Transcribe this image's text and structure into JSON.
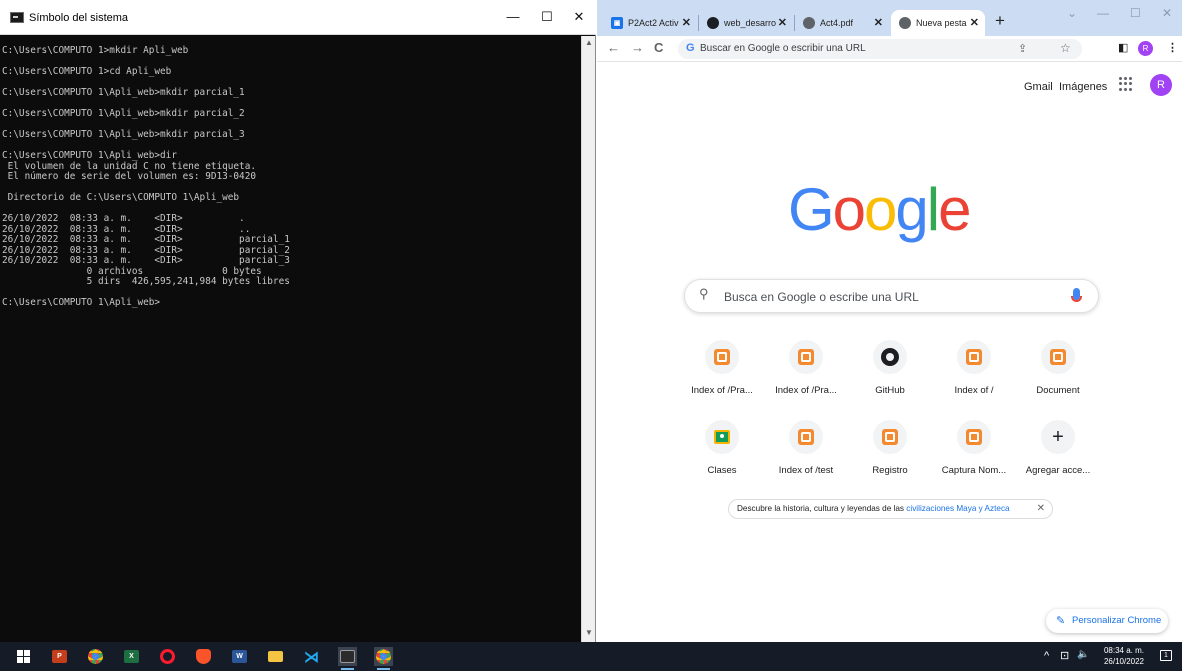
{
  "cmd": {
    "title": "Símbolo del sistema",
    "icon": "cmd-app-icon",
    "controls": {
      "minimize": "—",
      "maximize": "☐",
      "close": "✕"
    },
    "output": "C:\\Users\\COMPUTO 1>mkdir Apli_web\n\nC:\\Users\\COMPUTO 1>cd Apli_web\n\nC:\\Users\\COMPUTO 1\\Apli_web>mkdir parcial_1\n\nC:\\Users\\COMPUTO 1\\Apli_web>mkdir parcial_2\n\nC:\\Users\\COMPUTO 1\\Apli_web>mkdir parcial_3\n\nC:\\Users\\COMPUTO 1\\Apli_web>dir\n El volumen de la unidad C no tiene etiqueta.\n El número de serie del volumen es: 9D13-0420\n\n Directorio de C:\\Users\\COMPUTO 1\\Apli_web\n\n26/10/2022  08:33 a. m.    <DIR>          .\n26/10/2022  08:33 a. m.    <DIR>          ..\n26/10/2022  08:33 a. m.    <DIR>          parcial_1\n26/10/2022  08:33 a. m.    <DIR>          parcial_2\n26/10/2022  08:33 a. m.    <DIR>          parcial_3\n               0 archivos              0 bytes\n               5 dirs  426,595,241,984 bytes libres\n\nC:\\Users\\COMPUTO 1\\Apli_web>"
  },
  "chrome": {
    "tabs": [
      {
        "label": "P2Act2 Activ",
        "favicon": "classroom-icon",
        "color": "#1a73e8"
      },
      {
        "label": "web_desarro",
        "favicon": "github-icon",
        "color": "#1b1f23"
      },
      {
        "label": "Act4.pdf",
        "favicon": "globe-icon",
        "color": "#5f6368"
      },
      {
        "label": "Nueva pesta",
        "favicon": "chrome-icon",
        "color": "#5f6368",
        "active": true
      }
    ],
    "tab_close": "✕",
    "new_tab": "+",
    "window_controls": {
      "chevron": "⌄",
      "minimize": "—",
      "maximize": "☐",
      "close": "✕"
    },
    "toolbar": {
      "back": "←",
      "forward": "→",
      "reload": "C",
      "omnibox_placeholder": "Buscar en Google o escribir una URL",
      "avatar_letter": "R",
      "menu": "⋮"
    },
    "ntp": {
      "links": {
        "gmail": "Gmail",
        "images": "Imágenes"
      },
      "avatar_letter": "R",
      "logo": [
        "G",
        "o",
        "o",
        "g",
        "l",
        "e"
      ],
      "search_placeholder": "Busca en Google o escribe una URL",
      "shortcuts": [
        {
          "label": "Index of /Pra...",
          "icon": "xampp-icon"
        },
        {
          "label": "Index of /Pra...",
          "icon": "xampp-icon"
        },
        {
          "label": "GitHub",
          "icon": "github-icon"
        },
        {
          "label": "Index of /",
          "icon": "xampp-icon"
        },
        {
          "label": "Document",
          "icon": "xampp-icon"
        },
        {
          "label": "Clases",
          "icon": "classroom-icon"
        },
        {
          "label": "Index of /test",
          "icon": "xampp-icon"
        },
        {
          "label": "Registro",
          "icon": "xampp-icon"
        },
        {
          "label": "Captura Nom...",
          "icon": "xampp-icon"
        },
        {
          "label": "Agregar acce...",
          "icon": "plus-icon"
        }
      ],
      "promo": {
        "text": "Descubre la historia, cultura y leyendas de las ",
        "link": "civilizaciones Maya y Azteca",
        "close": "✕"
      },
      "customize_label": "Personalizar Chrome"
    }
  },
  "taskbar": {
    "apps": [
      {
        "name": "start",
        "icon": "windows-icon"
      },
      {
        "name": "powerpoint",
        "icon": "powerpoint-icon",
        "color": "#c43e1c",
        "letter": "P"
      },
      {
        "name": "chrome",
        "icon": "chrome-icon"
      },
      {
        "name": "excel",
        "icon": "excel-icon",
        "color": "#1d6f42",
        "letter": "X"
      },
      {
        "name": "opera",
        "icon": "opera-icon",
        "color": "#ff1b2d"
      },
      {
        "name": "brave",
        "icon": "brave-icon",
        "color": "#fb542b"
      },
      {
        "name": "word",
        "icon": "word-icon",
        "color": "#2b579a",
        "letter": "W"
      },
      {
        "name": "file-explorer",
        "icon": "folder-icon",
        "color": "#f4c542"
      },
      {
        "name": "vscode",
        "icon": "vscode-icon",
        "color": "#23a9f2"
      },
      {
        "name": "cmd",
        "icon": "cmd-icon",
        "active": true
      },
      {
        "name": "chrome-profile",
        "icon": "chrome-icon",
        "active": true
      }
    ],
    "tray": {
      "chevron": "^",
      "network": "⊡",
      "volume": "🔈"
    },
    "time": "08:34 a. m.",
    "date": "26/10/2022",
    "notifications_count": "1"
  }
}
